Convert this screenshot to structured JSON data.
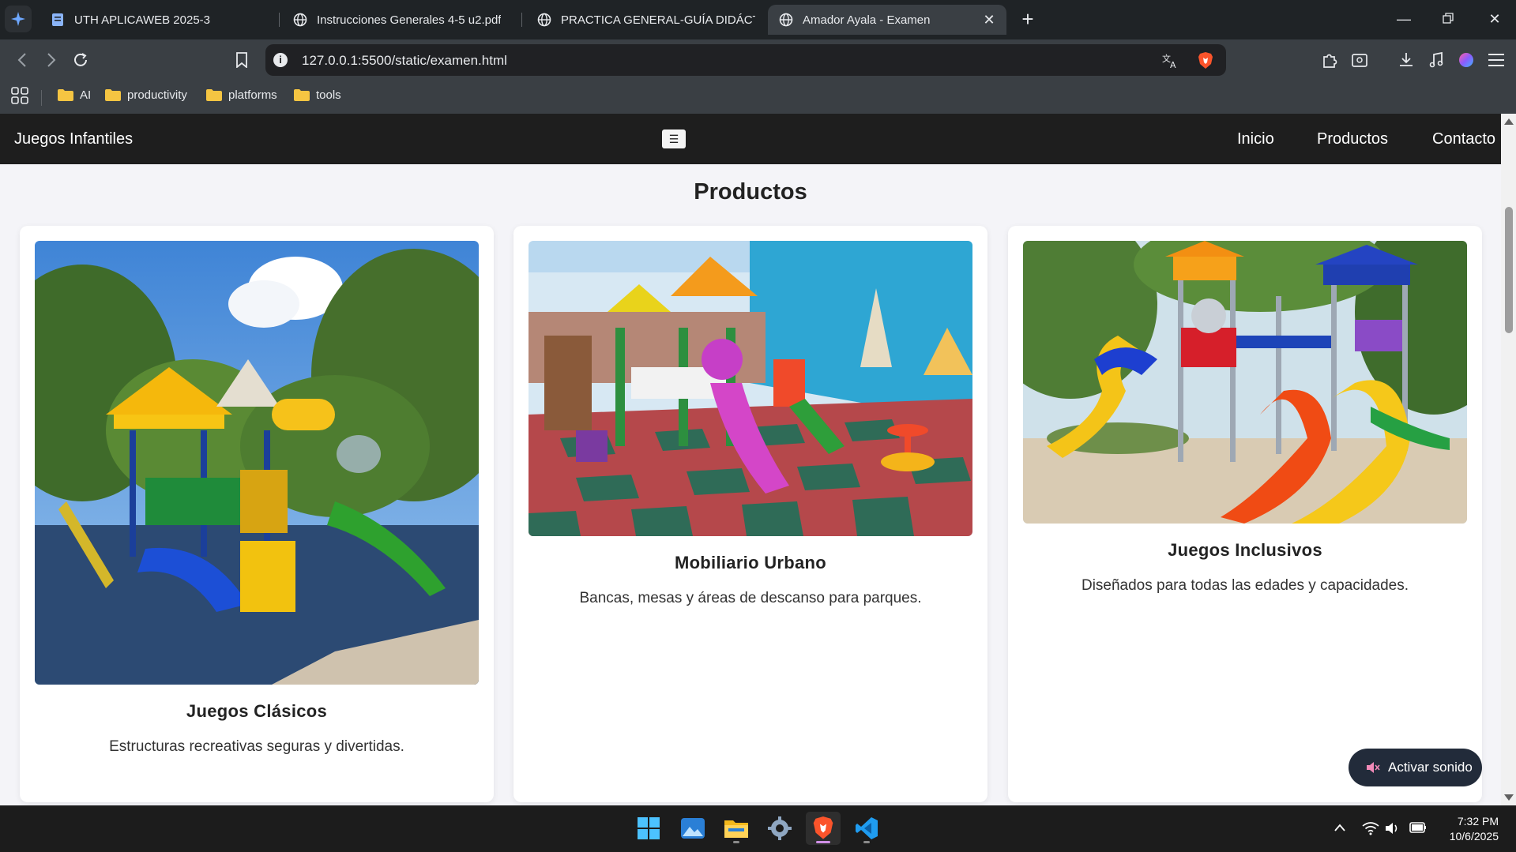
{
  "browser": {
    "tabs": [
      {
        "label": "UTH APLICAWEB 2025-3",
        "icon": "document-icon",
        "active": false
      },
      {
        "label": "Instrucciones Generales 4-5 u2.pdf",
        "icon": "globe-icon",
        "active": false
      },
      {
        "label": "PRACTICA GENERAL-GUÍA DIDÁCTICA",
        "icon": "globe-icon",
        "active": false
      },
      {
        "label": "Amador Ayala - Examen",
        "icon": "globe-icon",
        "active": true
      }
    ],
    "address": "127.0.0.1:5500/static/examen.html",
    "bookmarks": [
      "AI",
      "productivity",
      "platforms",
      "tools"
    ]
  },
  "site": {
    "brand": "Juegos Infantiles",
    "menu_toggle": "☰",
    "nav": [
      "Inicio",
      "Productos",
      "Contacto"
    ],
    "section_title": "Productos",
    "products": [
      {
        "title": "Juegos Clásicos",
        "description": "Estructuras recreativas seguras y divertidas."
      },
      {
        "title": "Mobiliario Urbano",
        "description": "Bancas, mesas y áreas de descanso para parques."
      },
      {
        "title": "Juegos Inclusivos",
        "description": "Diseñados para todas las edades y capacidades."
      }
    ],
    "sound_button": "Activar sonido"
  },
  "taskbar": {
    "apps": [
      "windows-start-icon",
      "photos-icon",
      "file-explorer-icon",
      "settings-icon",
      "brave-browser-icon",
      "vscode-icon"
    ],
    "time": "7:32 PM",
    "date": "10/6/2025"
  }
}
